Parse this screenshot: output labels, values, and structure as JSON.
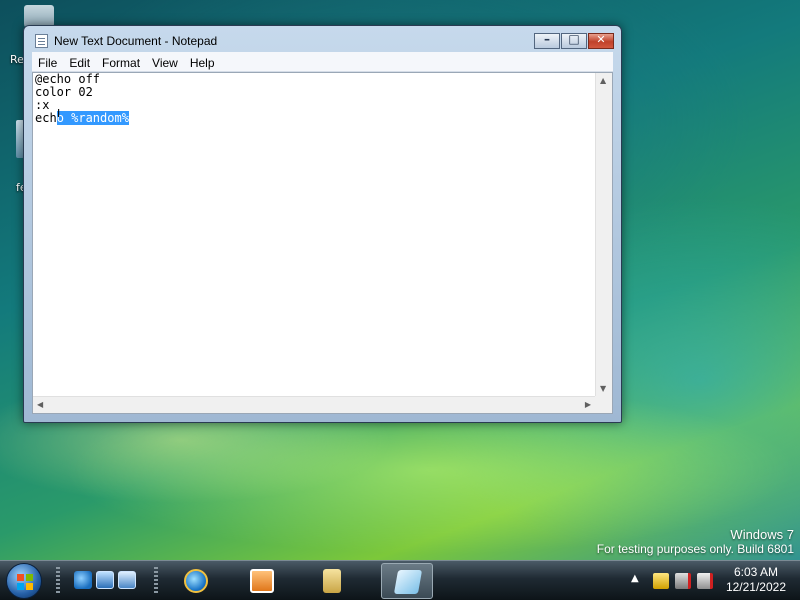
{
  "desktop": {
    "icons": [
      {
        "label": "Re"
      },
      {
        "label": "fe"
      }
    ],
    "brand_line1": "Windows 7",
    "brand_line2": "For testing purposes only. Build 6801"
  },
  "notepad": {
    "title": "New Text Document - Notepad",
    "menu": [
      "File",
      "Edit",
      "Format",
      "View",
      "Help"
    ],
    "lines": [
      "@echo off",
      "color 02",
      ":x"
    ],
    "line4_unselected": "ech",
    "line4_selected": "o %random%"
  },
  "taskbar": {
    "quick_launch": [
      "internet-explorer-icon",
      "show-desktop-icon",
      "switch-windows-icon"
    ],
    "buttons": [
      "internet-explorer-icon",
      "media-player-icon",
      "library-folder-icon",
      "notepad-icon"
    ],
    "clock_time": "6:03 AM",
    "clock_date": "12/21/2022"
  },
  "colors": {
    "selection": "#3399ff",
    "title_bar": "#b9cde4",
    "taskbar": "#1f2a33"
  }
}
